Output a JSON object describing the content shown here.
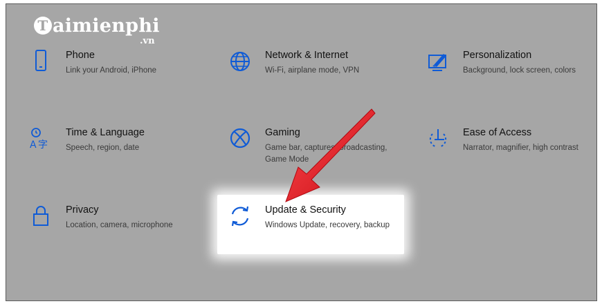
{
  "logo": {
    "badge": "T",
    "text": "aimienphi",
    "sub": ".vn"
  },
  "tiles": [
    {
      "title": "Phone",
      "desc": "Link your Android, iPhone",
      "icon": "phone-icon"
    },
    {
      "title": "Network & Internet",
      "desc": "Wi-Fi, airplane mode, VPN",
      "icon": "globe-icon"
    },
    {
      "title": "Personalization",
      "desc": "Background, lock screen, colors",
      "icon": "personalization-icon"
    },
    {
      "title": "Time & Language",
      "desc": "Speech, region, date",
      "icon": "time-language-icon"
    },
    {
      "title": "Gaming",
      "desc": "Game bar, captures, broadcasting, Game Mode",
      "icon": "xbox-icon"
    },
    {
      "title": "Ease of Access",
      "desc": "Narrator, magnifier, high contrast",
      "icon": "ease-of-access-icon"
    },
    {
      "title": "Privacy",
      "desc": "Location, camera, microphone",
      "icon": "lock-icon"
    },
    {
      "title": "Update & Security",
      "desc": "Windows Update, recovery, backup",
      "icon": "sync-icon"
    }
  ],
  "colors": {
    "background_dim": "#a6a6a6",
    "icon_blue": "#0f5bd6",
    "arrow_red": "#e0161d",
    "highlight": "#ffffff"
  }
}
